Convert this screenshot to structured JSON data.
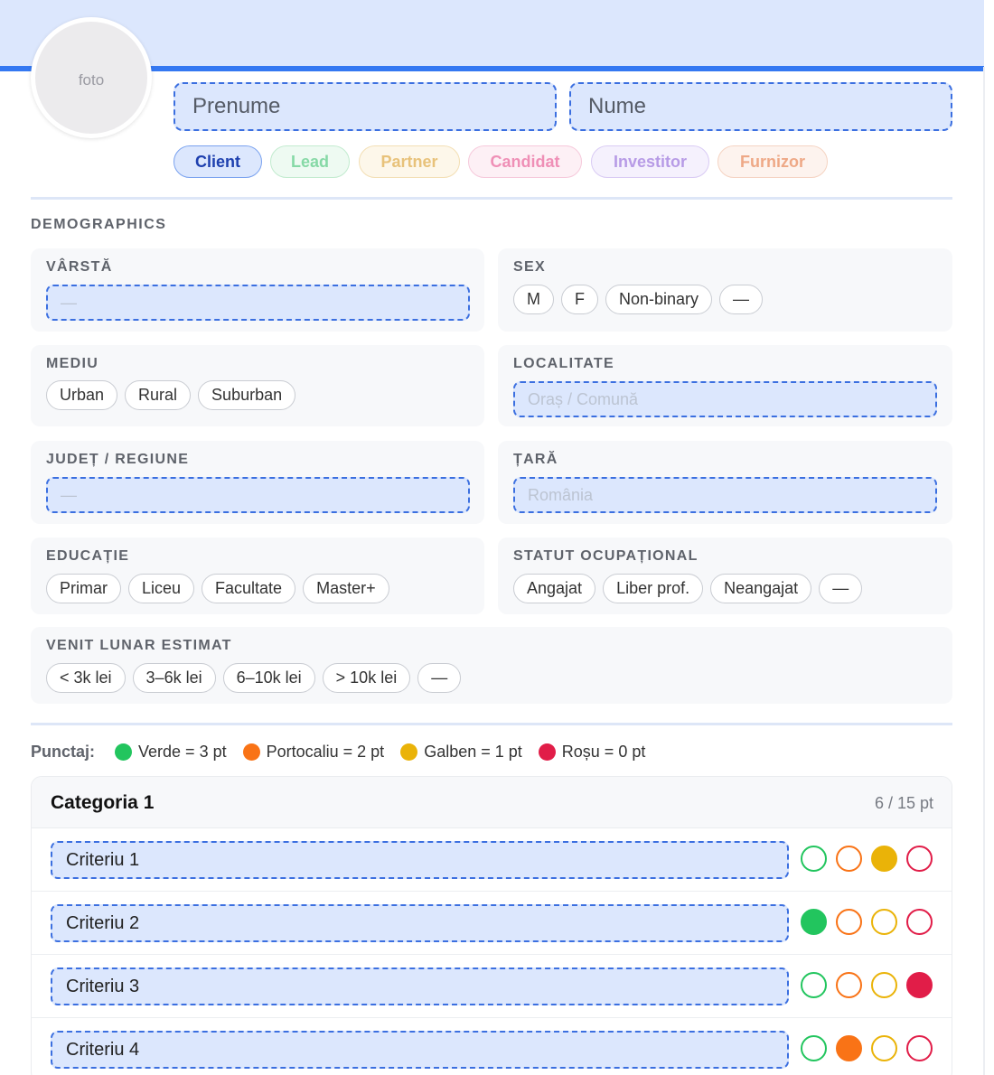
{
  "header": {
    "avatar_label": "foto",
    "first_name_placeholder": "Prenume",
    "last_name_placeholder": "Nume",
    "tags": [
      {
        "label": "Client",
        "active": true,
        "color": "#1e40af"
      },
      {
        "label": "Lead",
        "active": false,
        "color": "#86d9a6"
      },
      {
        "label": "Partner",
        "active": false,
        "color": "#e8c27a"
      },
      {
        "label": "Candidat",
        "active": false,
        "color": "#ef8fb6"
      },
      {
        "label": "Investitor",
        "active": false,
        "color": "#b79be6"
      },
      {
        "label": "Furnizor",
        "active": false,
        "color": "#eea886"
      }
    ]
  },
  "demographics": {
    "title": "DEMOGRAPHICS",
    "age": {
      "label": "VÂRSTĂ",
      "placeholder": "—"
    },
    "sex": {
      "label": "SEX",
      "options": [
        "M",
        "F",
        "Non-binary",
        "—"
      ]
    },
    "environment": {
      "label": "MEDIU",
      "options": [
        "Urban",
        "Rural",
        "Suburban"
      ]
    },
    "locality": {
      "label": "LOCALITATE",
      "placeholder": "Oraș / Comună"
    },
    "county": {
      "label": "JUDEȚ / REGIUNE",
      "placeholder": "—"
    },
    "country": {
      "label": "ȚARĂ",
      "placeholder": "România"
    },
    "education": {
      "label": "EDUCAȚIE",
      "options": [
        "Primar",
        "Liceu",
        "Facultate",
        "Master+"
      ]
    },
    "occupation": {
      "label": "STATUT OCUPAȚIONAL",
      "options": [
        "Angajat",
        "Liber prof.",
        "Neangajat",
        "—"
      ]
    },
    "income": {
      "label": "VENIT LUNAR ESTIMAT",
      "options": [
        "< 3k lei",
        "3–6k lei",
        "6–10k lei",
        "> 10k lei",
        "—"
      ]
    }
  },
  "scoring": {
    "label": "Punctaj:",
    "levels": [
      {
        "text": "Verde = 3 pt",
        "color": "#22c55e"
      },
      {
        "text": "Portocaliu = 2 pt",
        "color": "#f97316"
      },
      {
        "text": "Galben = 1 pt",
        "color": "#eab308"
      },
      {
        "text": "Roșu = 0 pt",
        "color": "#e11d48"
      }
    ]
  },
  "category": {
    "title": "Categoria 1",
    "score": "6 / 15 pt",
    "criteria": [
      {
        "label": "Criteriu 1",
        "selected": "yellow"
      },
      {
        "label": "Criteriu 2",
        "selected": "green"
      },
      {
        "label": "Criteriu 3",
        "selected": "red"
      },
      {
        "label": "Criteriu 4",
        "selected": "orange"
      }
    ]
  }
}
